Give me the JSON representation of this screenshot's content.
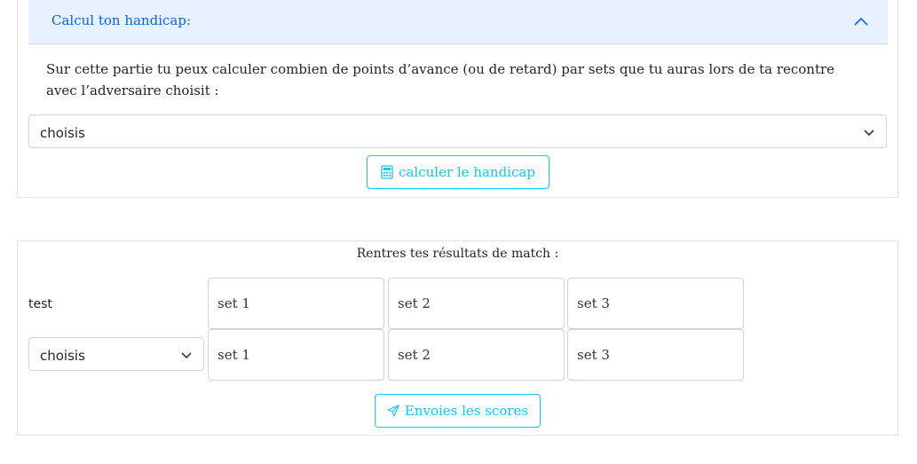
{
  "handicap": {
    "title": "Calcul ton handicap:",
    "description": "Sur cette partie tu peux calculer combien de points d’avance (ou de retard) par sets que tu auras lors de ta recontre avec l’adversaire choisit :",
    "select_value": "choisis",
    "button_label": "calculer le handicap",
    "button_icon": "calculator-icon",
    "header_icon": "chevron-up-icon"
  },
  "results": {
    "title": "Rentres tes résultats de match :",
    "player_label": "test",
    "opponent_select_value": "choisis",
    "rows": [
      {
        "sets": [
          "set 1",
          "set 2",
          "set 3"
        ]
      },
      {
        "sets": [
          "set 1",
          "set 2",
          "set 3"
        ]
      }
    ],
    "button_label": "Envoies les scores",
    "button_icon": "send-icon"
  },
  "colors": {
    "accent": "#0dcaf0",
    "accordion_bg": "#e7f1ff",
    "accordion_text": "#0c63e4"
  }
}
